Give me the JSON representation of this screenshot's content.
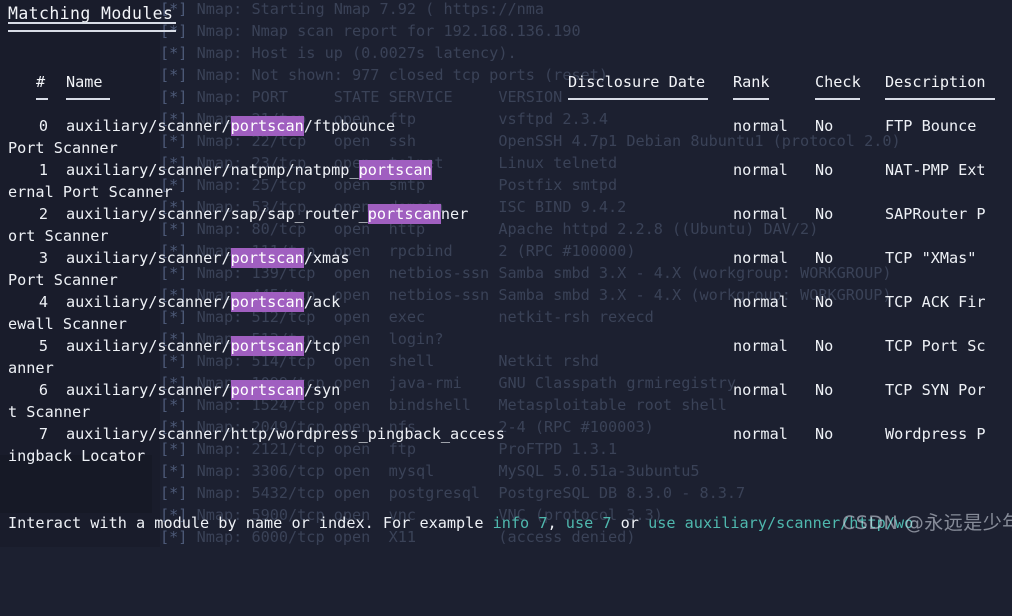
{
  "panel": {
    "title": "Matching Modules",
    "footer": {
      "prefix": "Interact with a module by name or index. For example ",
      "cmd1": "info 7",
      "sep1": ", ",
      "cmd2": "use 7",
      "sep2": " or ",
      "cmd3": "use auxiliary/scanner/http/wo"
    },
    "watermark": "CSDN @永远是少年啊"
  },
  "table": {
    "headers": {
      "index": "#",
      "name": "Name",
      "disclosure_date": "Disclosure Date",
      "rank": "Rank",
      "check": "Check",
      "description": "Description"
    },
    "rows": [
      {
        "index": "0",
        "name_pre": "auxiliary/scanner/",
        "name_hl": "portscan",
        "name_post": "/ftpbounce",
        "disclosure_date": "",
        "rank": "normal",
        "check": "No",
        "description": "FTP Bounce",
        "description_wrap": "Port Scanner"
      },
      {
        "index": "1",
        "name_pre": "auxiliary/scanner/natpmp/natpmp_",
        "name_hl": "portscan",
        "name_post": "",
        "disclosure_date": "",
        "rank": "normal",
        "check": "No",
        "description": "NAT-PMP Ext",
        "description_wrap": "ernal Port Scanner"
      },
      {
        "index": "2",
        "name_pre": "auxiliary/scanner/sap/sap_router_",
        "name_hl": "portscan",
        "name_post": "ner",
        "disclosure_date": "",
        "rank": "normal",
        "check": "No",
        "description": "SAPRouter P",
        "description_wrap": "ort Scanner"
      },
      {
        "index": "3",
        "name_pre": "auxiliary/scanner/",
        "name_hl": "portscan",
        "name_post": "/xmas",
        "disclosure_date": "",
        "rank": "normal",
        "check": "No",
        "description": "TCP \"XMas\"",
        "description_wrap": "Port Scanner"
      },
      {
        "index": "4",
        "name_pre": "auxiliary/scanner/",
        "name_hl": "portscan",
        "name_post": "/ack",
        "disclosure_date": "",
        "rank": "normal",
        "check": "No",
        "description": "TCP ACK Fir",
        "description_wrap": "ewall Scanner"
      },
      {
        "index": "5",
        "name_pre": "auxiliary/scanner/",
        "name_hl": "portscan",
        "name_post": "/tcp",
        "disclosure_date": "",
        "rank": "normal",
        "check": "No",
        "description": "TCP Port Sc",
        "description_wrap": "anner"
      },
      {
        "index": "6",
        "name_pre": "auxiliary/scanner/",
        "name_hl": "portscan",
        "name_post": "/syn",
        "disclosure_date": "",
        "rank": "normal",
        "check": "No",
        "description": "TCP SYN Por",
        "description_wrap": "t Scanner"
      },
      {
        "index": "7",
        "name_pre": "auxiliary/scanner/http/wordpress_pingback_access",
        "name_hl": "",
        "name_post": "",
        "disclosure_date": "",
        "rank": "normal",
        "check": "No",
        "description": "Wordpress P",
        "description_wrap": "ingback Locator"
      }
    ]
  },
  "background_terminal": {
    "lines": [
      "[*] Nmap: Starting Nmap 7.92 ( https://nma",
      "[*] Nmap: Nmap scan report for 192.168.136.190",
      "[*] Nmap: Host is up (0.0027s latency).",
      "[*] Nmap: Not shown: 977 closed tcp ports (reset)",
      "[*] Nmap: PORT     STATE SERVICE     VERSION",
      "[*] Nmap: 21/tcp   open  ftp         vsftpd 2.3.4",
      "[*] Nmap: 22/tcp   open  ssh         OpenSSH 4.7p1 Debian 8ubuntu1 (protocol 2.0)",
      "[*] Nmap: 23/tcp   open  telnet      Linux telnetd",
      "[*] Nmap: 25/tcp   open  smtp        Postfix smtpd",
      "[*] Nmap: 53/tcp   open  domain      ISC BIND 9.4.2",
      "[*] Nmap: 80/tcp   open  http        Apache httpd 2.2.8 ((Ubuntu) DAV/2)",
      "[*] Nmap: 111/tcp  open  rpcbind     2 (RPC #100000)",
      "[*] Nmap: 139/tcp  open  netbios-ssn Samba smbd 3.X - 4.X (workgroup: WORKGROUP)",
      "[*] Nmap: 445/tcp  open  netbios-ssn Samba smbd 3.X - 4.X (workgroup: WORKGROUP)",
      "[*] Nmap: 512/tcp  open  exec        netkit-rsh rexecd",
      "[*] Nmap: 513/tcp  open  login?",
      "[*] Nmap: 514/tcp  open  shell       Netkit rshd",
      "[*] Nmap: 1099/tcp open  java-rmi    GNU Classpath grmiregistry",
      "[*] Nmap: 1524/tcp open  bindshell   Metasploitable root shell",
      "[*] Nmap: 2049/tcp open  nfs         2-4 (RPC #100003)",
      "[*] Nmap: 2121/tcp open  ftp         ProFTPD 1.3.1",
      "[*] Nmap: 3306/tcp open  mysql       MySQL 5.0.51a-3ubuntu5",
      "[*] Nmap: 5432/tcp open  postgresql  PostgreSQL DB 8.3.0 - 8.3.7",
      "[*] Nmap: 5900/tcp open  vnc         VNC (protocol 3.3)",
      "[*] Nmap: 6000/tcp open  X11         (access denied)"
    ]
  },
  "colors": {
    "background": "#1c2030",
    "text": "#eef1f6",
    "highlight": "#a05fc0",
    "command": "#4fb8ae",
    "dim": "#3a4257"
  }
}
